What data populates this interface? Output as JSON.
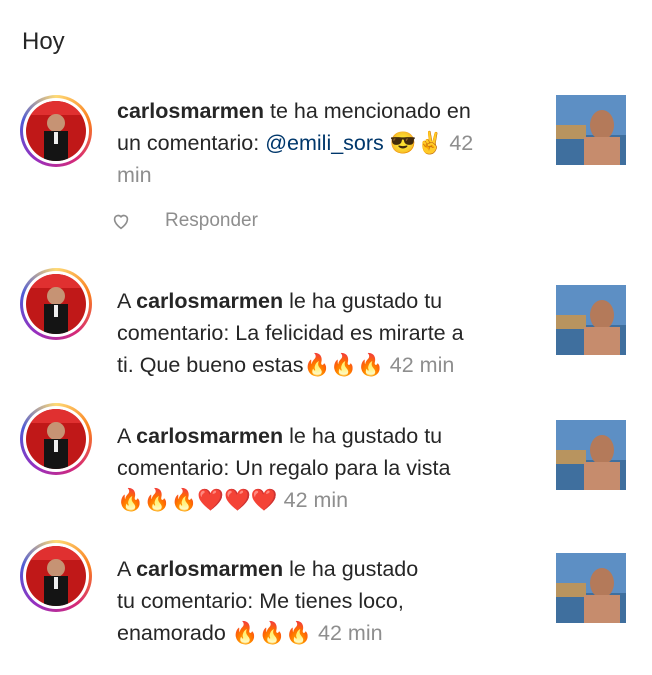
{
  "section": {
    "title": "Hoy"
  },
  "notifications": [
    {
      "line1_user": "carlosmarmen",
      "line1_rest": " te ha mencionado en",
      "line2_text": "un comentario: ",
      "line2_mention": "@emili_sors",
      "line2_emoji": " 😎✌️",
      "time": "42",
      "time_unit": "min",
      "reply_label": "Responder"
    },
    {
      "line1_pre": "A ",
      "line1_user": "carlosmarmen",
      "line1_rest": " le ha gustado tu",
      "line2_text": "comentario: La felicidad es mirarte a",
      "line3_text": "ti. Que bueno estas",
      "line3_emoji": "🔥🔥🔥",
      "time": "42 min"
    },
    {
      "line1_pre": "A ",
      "line1_user": "carlosmarmen",
      "line1_rest": " le ha gustado tu",
      "line2_text": "comentario: Un regalo para la vista",
      "line3_emoji": "🔥🔥🔥❤️❤️❤️",
      "time": "42 min"
    },
    {
      "line1_pre": "A ",
      "line1_user": "carlosmarmen",
      "line1_rest": " le ha gustado",
      "line2_text": "tu comentario: Me tienes loco,",
      "line3_text": "enamorado ",
      "line3_emoji": "🔥🔥🔥",
      "time": "42 min"
    }
  ],
  "colors": {
    "mention": "#00376b",
    "muted": "#8e8e8e",
    "text": "#262626"
  },
  "icons": [
    "heart-outline-icon"
  ]
}
